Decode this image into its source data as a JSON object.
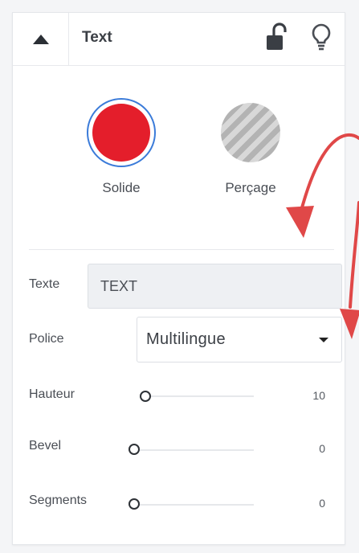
{
  "header": {
    "title": "Text",
    "icons": {
      "collapse": "triangle-up-icon",
      "lock": "unlock-icon",
      "bulb": "lightbulb-icon"
    }
  },
  "modes": {
    "solid": {
      "label": "Solide",
      "color": "#e41e2b",
      "selected": true
    },
    "hole": {
      "label": "Perçage",
      "selected": false
    }
  },
  "fields": {
    "text": {
      "label": "Texte",
      "value": "TEXT"
    },
    "font": {
      "label": "Police",
      "value": "Multilingue"
    },
    "height": {
      "label": "Hauteur",
      "value": "10",
      "level": 0
    },
    "bevel": {
      "label": "Bevel",
      "value": "0",
      "level": 0
    },
    "segments": {
      "label": "Segments",
      "value": "0",
      "level": 0
    }
  },
  "annotation_color": "#e04848"
}
